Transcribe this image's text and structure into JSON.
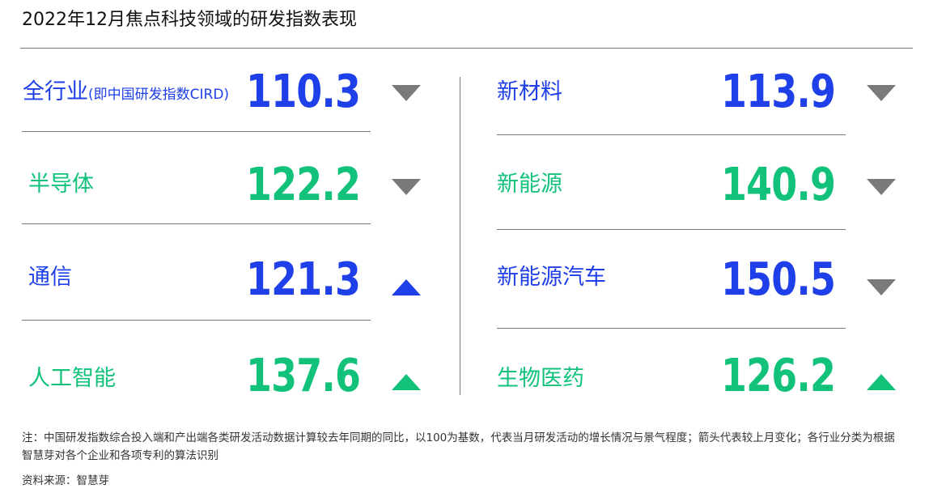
{
  "title": "2022年12月焦点科技领域的研发指数表现",
  "colors": {
    "blue": "#1f3fe8",
    "green": "#12c27a",
    "gray": "#7a7a7a"
  },
  "left": [
    {
      "label": "全行业",
      "sub": "(即中国研发指数CIRD)",
      "value": "110.3",
      "color": "blue",
      "arrow": "down",
      "arrow_color": "gray"
    },
    {
      "label": "半导体",
      "sub": "",
      "value": "122.2",
      "color": "green",
      "arrow": "down",
      "arrow_color": "gray"
    },
    {
      "label": "通信",
      "sub": "",
      "value": "121.3",
      "color": "blue",
      "arrow": "up",
      "arrow_color": "blue"
    },
    {
      "label": "人工智能",
      "sub": "",
      "value": "137.6",
      "color": "green",
      "arrow": "up",
      "arrow_color": "green"
    }
  ],
  "right": [
    {
      "label": "新材料",
      "sub": "",
      "value": "113.9",
      "color": "blue",
      "arrow": "down",
      "arrow_color": "gray"
    },
    {
      "label": "新能源",
      "sub": "",
      "value": "140.9",
      "color": "green",
      "arrow": "down",
      "arrow_color": "gray"
    },
    {
      "label": "新能源汽车",
      "sub": "",
      "value": "150.5",
      "color": "blue",
      "arrow": "down",
      "arrow_color": "gray"
    },
    {
      "label": "生物医药",
      "sub": "",
      "value": "126.2",
      "color": "green",
      "arrow": "up",
      "arrow_color": "green"
    }
  ],
  "note": "注：中国研发指数综合投入端和产出端各类研发活动数据计算较去年同期的同比，以100为基数，代表当月研发活动的增长情况与景气程度；箭头代表较上月变化；各行业分类为根据智慧芽对各个企业和各项专利的算法识别",
  "source": "资料来源：智慧芽"
}
